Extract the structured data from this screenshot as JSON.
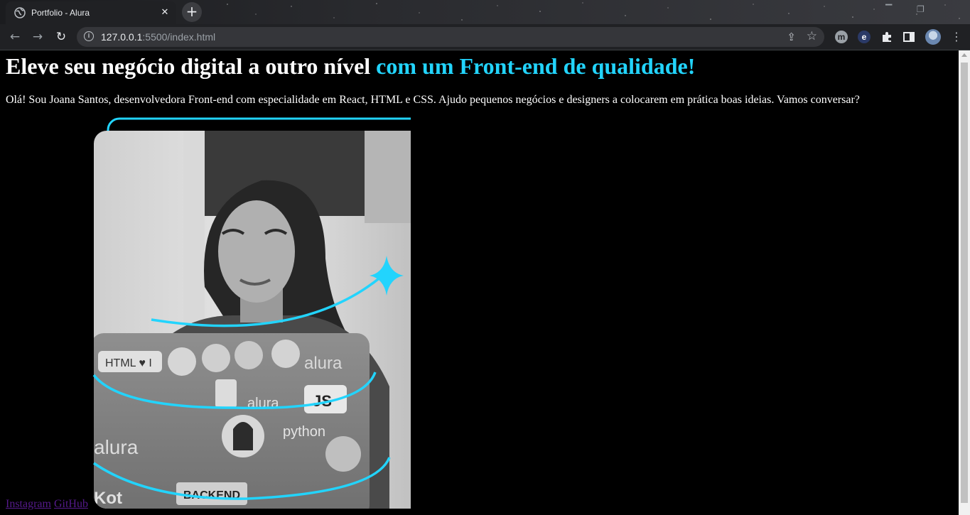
{
  "browser": {
    "tab_title": "Portfolio - Alura",
    "tab_close_icon": "close-icon",
    "new_tab_icon": "plus-icon",
    "url_host": "127.0.0.1",
    "url_rest": ":5500/index.html",
    "extensions": [
      "m",
      "e"
    ]
  },
  "page": {
    "headline_main": "Eleve seu negócio digital a outro nível ",
    "headline_accent": "com um Front-end de qualidade!",
    "intro": "Olá! Sou Joana Santos, desenvolvedora Front-end com especialidade em React, HTML e CSS. Ajudo pequenos negócios e designers a colocarem em prática boas ideias. Vamos conversar?",
    "links": [
      {
        "label": "Instagram"
      },
      {
        "label": "GitHub"
      }
    ],
    "sticker_text": {
      "html": "HTML ♥ I",
      "alura1": "alura",
      "alura2": "alura",
      "js": "JS",
      "python": "python",
      "alura3": "alura",
      "backend": "BACKEND",
      "kot": "Kot"
    }
  },
  "colors": {
    "accent": "#22d4fd",
    "link_visited": "#551a8b",
    "background": "#000000"
  }
}
